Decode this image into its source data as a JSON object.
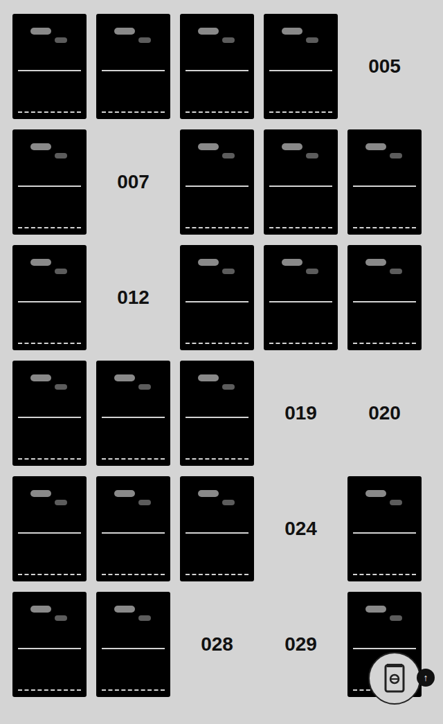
{
  "collection": {
    "slots": [
      {
        "owned": true
      },
      {
        "owned": true
      },
      {
        "owned": true
      },
      {
        "owned": true
      },
      {
        "owned": false,
        "number": "005"
      },
      {
        "owned": true
      },
      {
        "owned": false,
        "number": "007"
      },
      {
        "owned": true
      },
      {
        "owned": true
      },
      {
        "owned": true
      },
      {
        "owned": true
      },
      {
        "owned": false,
        "number": "012"
      },
      {
        "owned": true
      },
      {
        "owned": true
      },
      {
        "owned": true
      },
      {
        "owned": true
      },
      {
        "owned": true
      },
      {
        "owned": true
      },
      {
        "owned": false,
        "number": "019"
      },
      {
        "owned": false,
        "number": "020"
      },
      {
        "owned": true
      },
      {
        "owned": true
      },
      {
        "owned": true
      },
      {
        "owned": false,
        "number": "024"
      },
      {
        "owned": true
      },
      {
        "owned": true
      },
      {
        "owned": true
      },
      {
        "owned": false,
        "number": "028"
      },
      {
        "owned": false,
        "number": "029"
      },
      {
        "owned": true
      }
    ]
  },
  "scroll_top": {
    "label": "↑"
  }
}
